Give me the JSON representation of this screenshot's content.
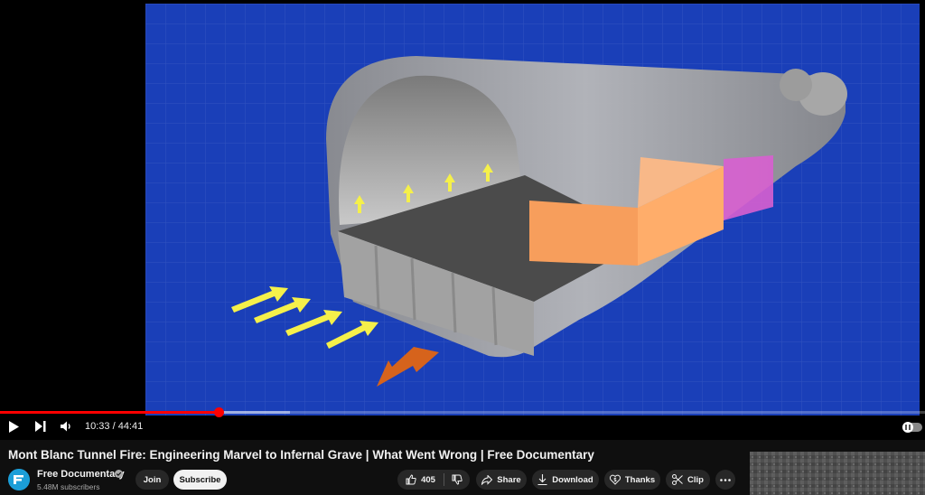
{
  "player": {
    "time_display": "10:33 / 44:41",
    "progress_fraction": 0.236,
    "buffered_fraction": 0.313,
    "accent_color": "#ff0000",
    "icons": {
      "play": "play-icon",
      "next": "next-icon",
      "volume": "volume-icon",
      "autoplay": "autoplay-toggle"
    }
  },
  "video": {
    "title": "Mont Blanc Tunnel Fire: Engineering Marvel to Infernal Grave | What Went Wrong | Free Documentary"
  },
  "channel": {
    "name": "Free Documentary",
    "subscribers": "5.48M subscribers",
    "verified": true
  },
  "actions": {
    "join": "Join",
    "subscribe": "Subscribe",
    "like_count": "405",
    "share": "Share",
    "download": "Download",
    "thanks": "Thanks",
    "clip": "Clip"
  }
}
